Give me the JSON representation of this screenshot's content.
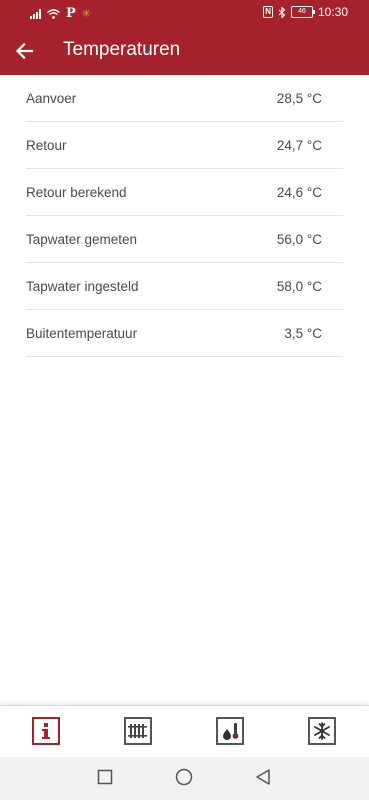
{
  "status_bar": {
    "time": "10:30",
    "battery": "46",
    "nfc": "N",
    "p_glyph": "P",
    "icons": [
      "signal-icon",
      "wifi-icon",
      "parking-icon",
      "notification-icon",
      "nfc-icon",
      "bluetooth-icon",
      "battery-icon"
    ]
  },
  "header": {
    "title": "Temperaturen",
    "back_icon": "arrow-left-icon"
  },
  "temperatures": [
    {
      "label": "Aanvoer",
      "value": "28,5 °C"
    },
    {
      "label": "Retour",
      "value": "24,7 °C"
    },
    {
      "label": "Retour berekend",
      "value": "24,6 °C"
    },
    {
      "label": "Tapwater gemeten",
      "value": "56,0 °C"
    },
    {
      "label": "Tapwater ingesteld",
      "value": "58,0 °C"
    },
    {
      "label": "Buitentemperatuur",
      "value": "3,5 °C"
    }
  ],
  "bottom_nav": {
    "items": [
      {
        "icon": "info-icon",
        "active": true
      },
      {
        "icon": "radiator-icon",
        "active": false
      },
      {
        "icon": "water-temperature-icon",
        "active": false
      },
      {
        "icon": "snowflake-icon",
        "active": false
      }
    ],
    "accent": "#a5222d"
  },
  "system_nav": {
    "items": [
      "recents-icon",
      "home-icon",
      "back-icon"
    ]
  },
  "colors": {
    "brand": "#a5222d",
    "text": "#4a4a4a",
    "divider": "#e2e2e2"
  }
}
